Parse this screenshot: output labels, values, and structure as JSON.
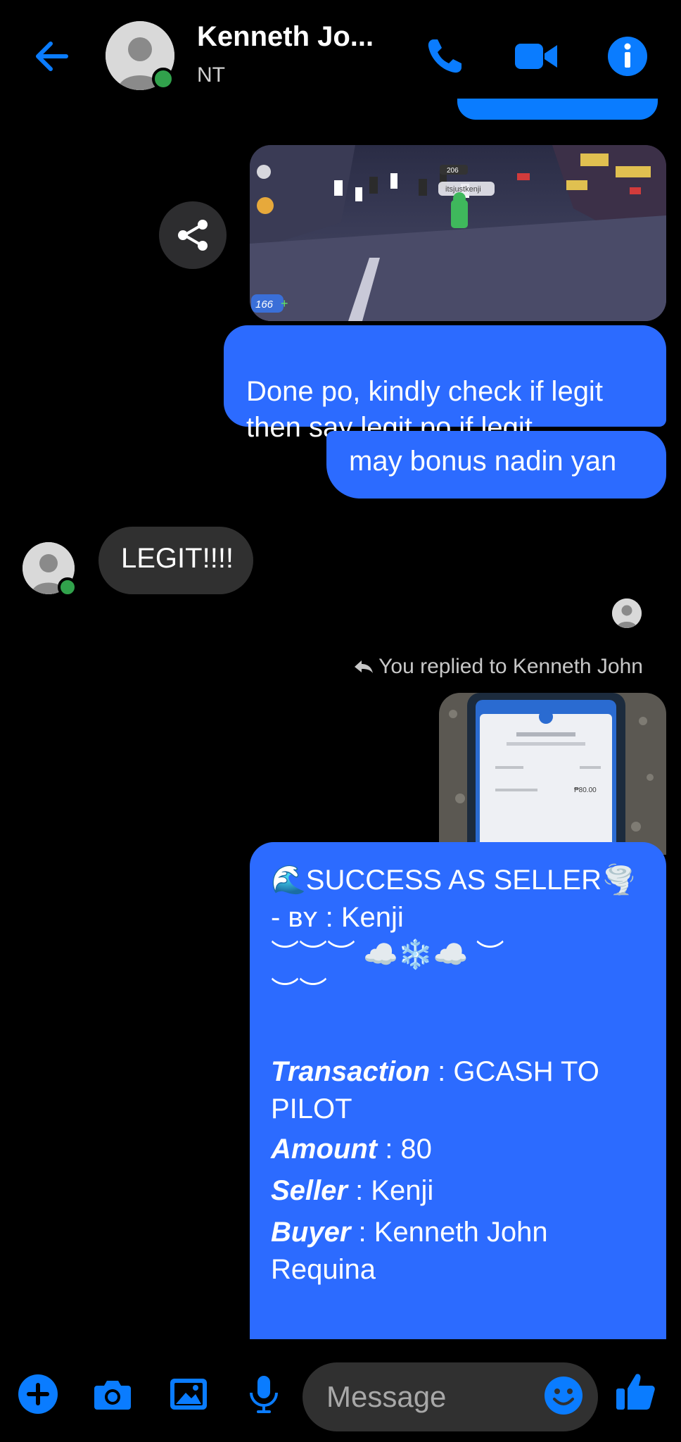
{
  "header": {
    "contact_name": "Kenneth Jo...",
    "status": "NT",
    "icons": [
      "back-arrow-icon",
      "phone-icon",
      "video-camera-icon",
      "info-icon"
    ]
  },
  "messages": {
    "msg1": "Done po, kindly check if legit\nthen say legit po if legit",
    "msg2": "may bonus nadin yan",
    "msg3": "LEGIT!!!!",
    "reply_note": "You replied to Kenneth John"
  },
  "game_screenshot": {
    "player_tag": "itsjustkenji",
    "gem_count": "166",
    "badge_count": "206"
  },
  "receipt_image": {
    "amount": "₱80.00"
  },
  "success_message": {
    "title": "🌊SUCCESS AS SELLER🌪️",
    "by_line_prefix": "- ʙʏ : ",
    "by_line_name": "Kenji",
    "decor": "︶︶︶ ☁️❄️☁️ ︶\n︶︶",
    "transaction_label": "Transaction",
    "transaction_value": " : GCASH TO PILOT",
    "amount_label": "Amount",
    "amount_value": " : 80",
    "seller_label": "Seller",
    "seller_value": " : Kenji",
    "buyer_label": "Buyer",
    "buyer_value": " : Kenneth John Requina"
  },
  "composer": {
    "placeholder": "Message",
    "icons": [
      "plus-icon",
      "camera-icon",
      "image-icon",
      "microphone-icon",
      "emoji-icon",
      "thumbs-up-icon"
    ]
  },
  "colors": {
    "accent": "#0a7cff",
    "bubble_out": "#2c6bff",
    "bubble_in": "#303030",
    "online": "#31a24c"
  }
}
